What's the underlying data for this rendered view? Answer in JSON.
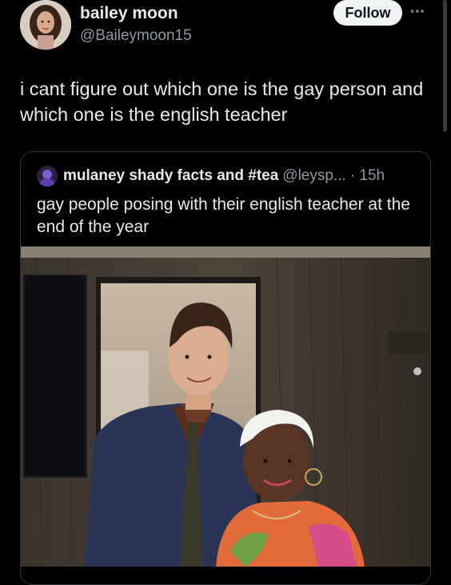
{
  "author": {
    "name": "bailey moon",
    "handle": "@Baileymoon15",
    "follow_label": "Follow",
    "more_label": "•••"
  },
  "tweet": {
    "text": "i cant figure out which one is the gay person and which one is the english teacher"
  },
  "quoted": {
    "name": "mulaney shady facts and #tea",
    "handle": "@leysp...",
    "time": "· 15h",
    "text": "gay people posing with their english teacher at the end of the year"
  },
  "icons": [
    "more-icon",
    "avatar",
    "quoted-avatar"
  ],
  "colors": {
    "background": "#000000",
    "text": "#e7e9ea",
    "muted": "#8b98a5",
    "border": "#2f3336",
    "follow_bg": "#eff3f4"
  }
}
